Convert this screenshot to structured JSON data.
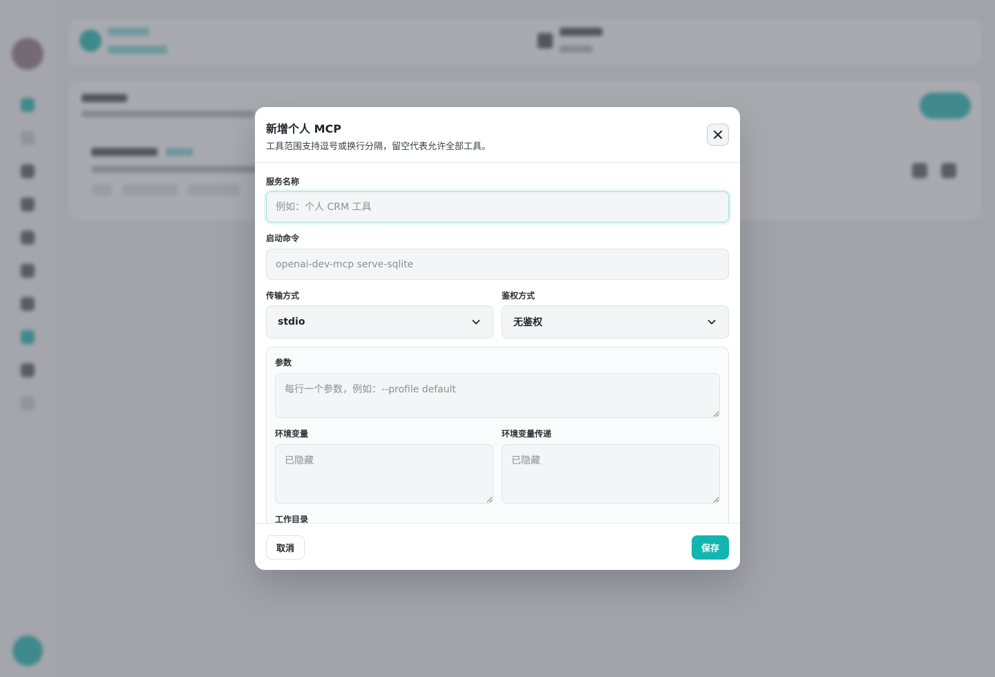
{
  "modal": {
    "title": "新增个人 MCP",
    "subtitle": "工具范围支持逗号或换行分隔，留空代表允许全部工具。",
    "close_icon": "close-icon"
  },
  "form": {
    "service_name": {
      "label": "服务名称",
      "placeholder": "例如：个人 CRM 工具",
      "value": ""
    },
    "command": {
      "label": "启动命令",
      "placeholder": "openai-dev-mcp serve-sqlite",
      "value": ""
    },
    "transport": {
      "label": "传输方式",
      "selected": "stdio",
      "icon": "chevron-down-icon"
    },
    "auth": {
      "label": "鉴权方式",
      "selected": "无鉴权",
      "icon": "chevron-down-icon"
    },
    "params": {
      "label": "参数",
      "placeholder": "每行一个参数，例如：--profile default"
    },
    "env": {
      "label": "环境变量",
      "placeholder": "已隐藏"
    },
    "env_passthrough": {
      "label": "环境变量传递",
      "placeholder": "已隐藏"
    },
    "workdir": {
      "label": "工作目录"
    }
  },
  "footer": {
    "cancel_label": "取消",
    "save_label": "保存"
  },
  "colors": {
    "accent": "#12b5b0",
    "overlay": "#646870"
  }
}
